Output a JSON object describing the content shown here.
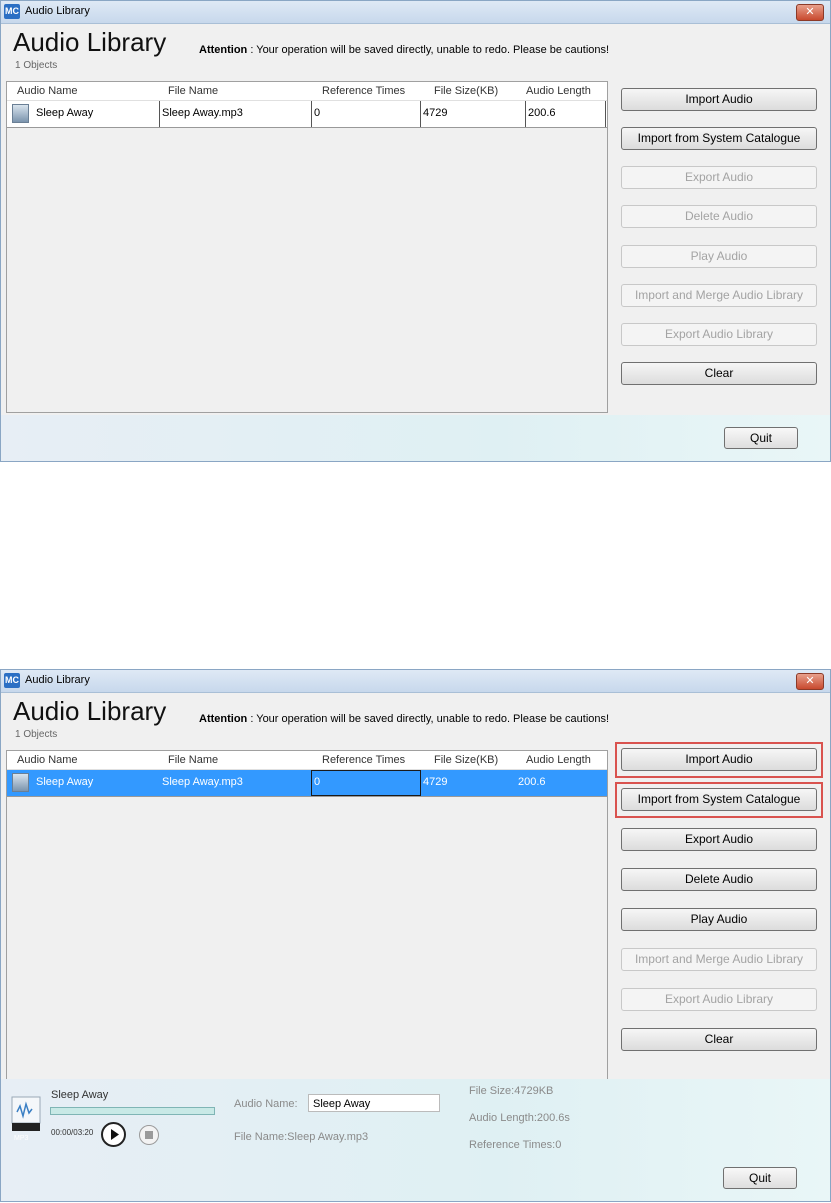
{
  "window": {
    "title": "Audio Library",
    "app_badge": "MC",
    "close_glyph": "✕"
  },
  "header": {
    "title": "Audio Library",
    "attention_label": "Attention",
    "attention_text": " : Your operation will be saved directly, unable to redo. Please be cautions!",
    "count": "1 Objects"
  },
  "table": {
    "columns": [
      "Audio Name",
      "File Name",
      "Reference Times",
      "File Size(KB)",
      "Audio Length"
    ],
    "rows": [
      {
        "audio_name": "Sleep Away",
        "file_name": "Sleep Away.mp3",
        "reference_times": "0",
        "file_size": "4729",
        "audio_length": "200.6"
      }
    ]
  },
  "buttons": {
    "import_audio": "Import Audio",
    "import_system": "Import from System Catalogue",
    "export_audio": "Export Audio",
    "delete_audio": "Delete Audio",
    "play_audio": "Play Audio",
    "import_merge": "Import and Merge Audio Library",
    "export_library": "Export Audio Library",
    "clear": "Clear",
    "quit": "Quit"
  },
  "player": {
    "track": "Sleep Away",
    "time": "00:00/03:20",
    "file_badge": "MP3",
    "audio_name_label": "Audio Name:",
    "audio_name_value": "Sleep Away",
    "file_name_text": "File Name:Sleep Away.mp3",
    "file_size_text": "File Size:4729KB",
    "audio_length_text": "Audio Length:200.6s",
    "reference_times_text": "Reference Times:0",
    "progress": 0
  },
  "icons": {
    "play": "play-icon",
    "stop": "stop-icon",
    "audio_file": "audio-file-icon"
  },
  "colors": {
    "selection": "#3399ff",
    "highlight_box": "#d9534f"
  }
}
